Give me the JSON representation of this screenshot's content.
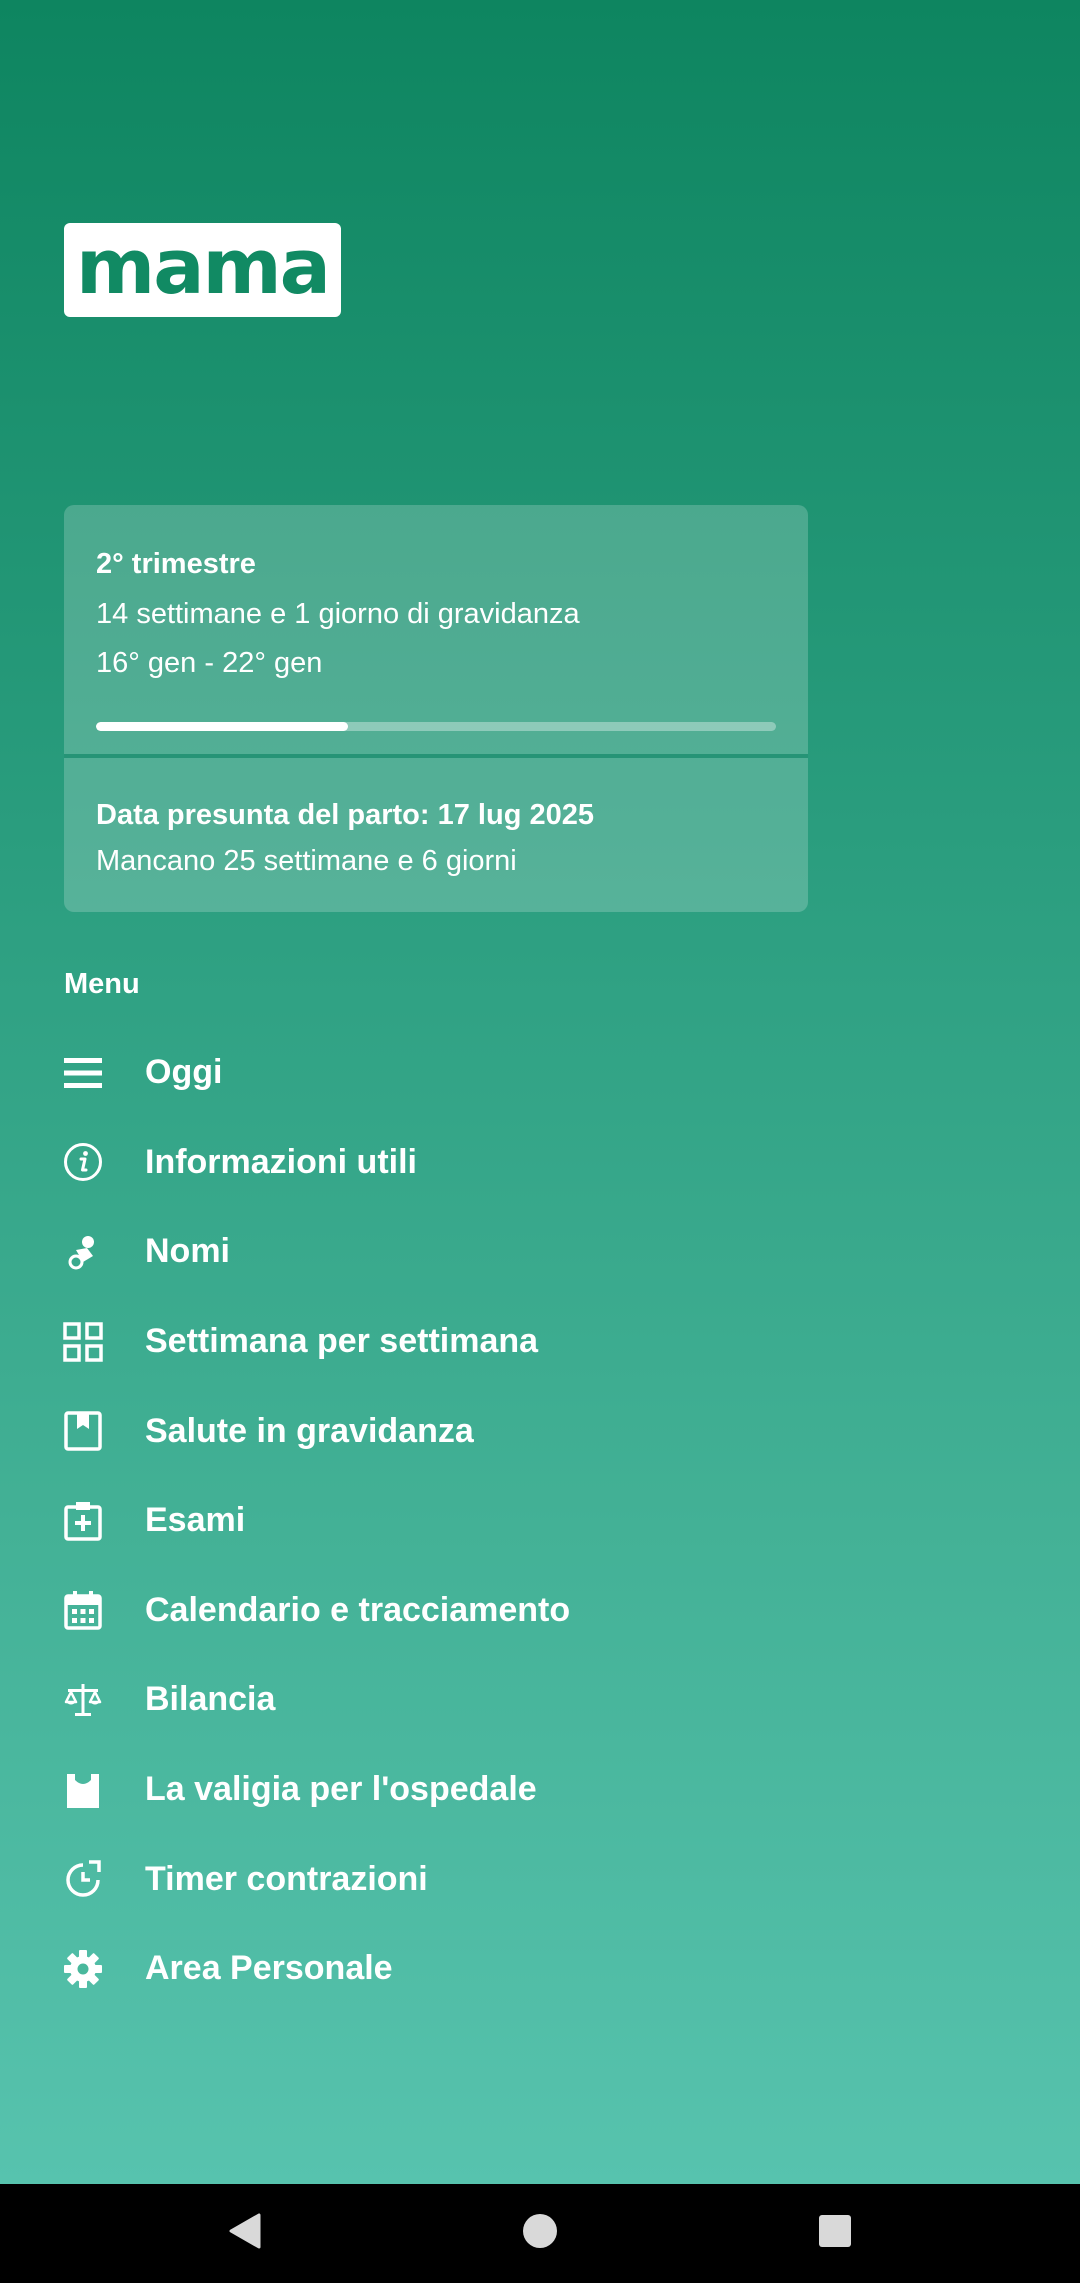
{
  "app": {
    "logo_text": "mama",
    "accent": "#118a63"
  },
  "pregnancy": {
    "trimester": "2° trimestre",
    "duration": "14 settimane e 1 giorno di gravidanza",
    "week_range": "16° gen - 22° gen",
    "progress_percent": 37,
    "due_date_label": "Data presunta del parto: 17 lug 2025",
    "remaining": "Mancano 25 settimane e 6 giorni"
  },
  "menu": {
    "title": "Menu",
    "items": [
      {
        "label": "Oggi",
        "icon": "menu-lines-icon"
      },
      {
        "label": "Informazioni utili",
        "icon": "info-icon"
      },
      {
        "label": "Nomi",
        "icon": "pacifier-icon"
      },
      {
        "label": "Settimana per settimana",
        "icon": "grid-icon"
      },
      {
        "label": "Salute in gravidanza",
        "icon": "bookmark-book-icon"
      },
      {
        "label": "Esami",
        "icon": "medical-clipboard-icon"
      },
      {
        "label": "Calendario e tracciamento",
        "icon": "calendar-icon"
      },
      {
        "label": "Bilancia",
        "icon": "scale-icon"
      },
      {
        "label": "La valigia per l'ospedale",
        "icon": "bag-icon"
      },
      {
        "label": "Timer contrazioni",
        "icon": "timer-icon"
      },
      {
        "label": "Area Personale",
        "icon": "gear-icon"
      }
    ]
  },
  "navbar": {
    "back": "back-icon",
    "home": "home-icon",
    "recents": "recents-icon"
  }
}
